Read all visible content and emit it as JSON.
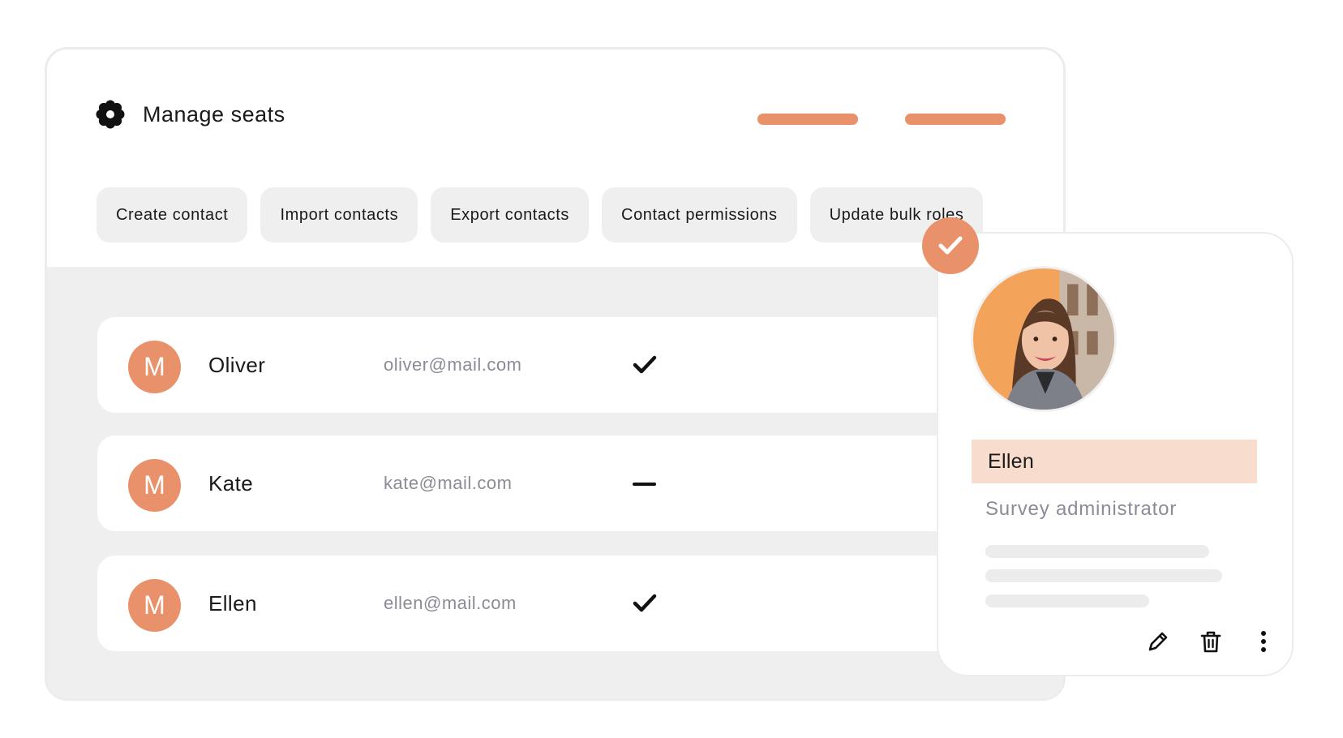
{
  "colors": {
    "accent": "#e9916a",
    "highlight": "#f8dccd",
    "muted_text": "#8b8b96",
    "panel_bg": "#efefef"
  },
  "header": {
    "icon": "gear-icon",
    "title": "Manage seats"
  },
  "toolbar": {
    "buttons": [
      {
        "label": "Create contact"
      },
      {
        "label": "Import contacts"
      },
      {
        "label": "Export contacts"
      },
      {
        "label": "Contact permissions"
      },
      {
        "label": "Update bulk roles"
      }
    ]
  },
  "contacts": [
    {
      "initial": "M",
      "name": "Oliver",
      "email": "oliver@mail.com",
      "status": "check-icon"
    },
    {
      "initial": "M",
      "name": "Kate",
      "email": "kate@mail.com",
      "status": "dash-icon"
    },
    {
      "initial": "M",
      "name": "Ellen",
      "email": "ellen@mail.com",
      "status": "check-icon"
    }
  ],
  "profile_card": {
    "selected_icon": "check-circle-icon",
    "name": "Ellen",
    "role": "Survey administrator",
    "actions": [
      "edit-icon",
      "trash-icon",
      "more-vertical-icon"
    ]
  }
}
